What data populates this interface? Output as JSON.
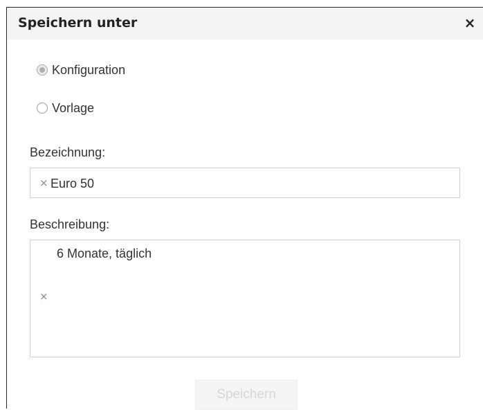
{
  "dialog": {
    "title": "Speichern unter",
    "close_symbol": "×"
  },
  "type_options": [
    {
      "label": "Konfiguration",
      "selected": true
    },
    {
      "label": "Vorlage",
      "selected": false
    }
  ],
  "name_field": {
    "label": "Bezeichnung:",
    "value": "Euro 50",
    "clear_symbol": "×"
  },
  "description_field": {
    "label": "Beschreibung:",
    "value": "6 Monate, täglich",
    "clear_symbol": "×"
  },
  "save_button": {
    "label": "Speichern",
    "enabled": false
  },
  "icons": {
    "close": "close-icon",
    "clear": "clear-icon",
    "radio_selected": "radio-selected-icon",
    "radio_unselected": "radio-unselected-icon"
  },
  "colors": {
    "title_bar_bg": "#f4f4f4",
    "disabled_text": "#d6d6d6",
    "border": "#cfcfcf"
  }
}
